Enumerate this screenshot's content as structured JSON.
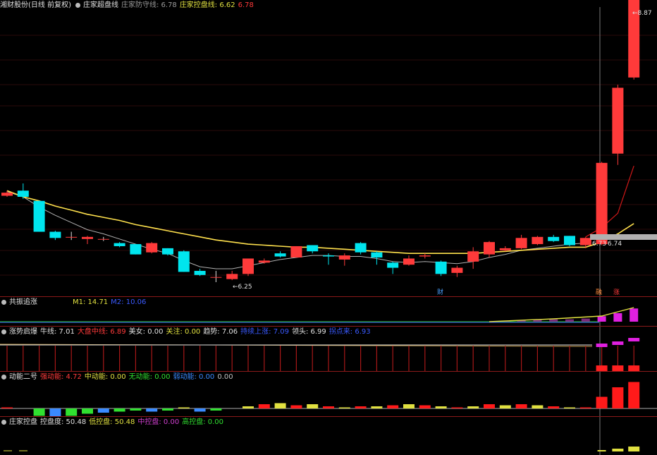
{
  "main": {
    "stock_title": "湘财股份(日线 前复权)",
    "indicator": "庄家超盘线",
    "defend_label": "庄家防守线: 6.78",
    "control_label": "庄家控盘线: 6.62",
    "extra_value": "6.78",
    "high_label": "8.87",
    "low_label": "6.25",
    "last_label_a": "6.73",
    "last_label_b": "6.74",
    "cai_badge": "财",
    "lu_badge": "融",
    "zhang_badge": "涨",
    "colors": {
      "up": "#ff3a3a",
      "down": "#00e5ee",
      "ma_fast": "#ffe14d",
      "ma_slow": "#b0b0b0",
      "ma_red": "#d01818"
    }
  },
  "panel2": {
    "name": "共振追涨",
    "m1": "M1: 14.71",
    "m2": "M2: 10.06"
  },
  "panel3": {
    "name": "涨势启爆",
    "items": [
      {
        "label": "牛线: 7.01",
        "color": "#e0e0e0"
      },
      {
        "label": "大盘中线: 6.89",
        "color": "#ff3a3a"
      },
      {
        "label": "美女: 0.00",
        "color": "#e0e0e0"
      },
      {
        "label": "关注: 0.00",
        "color": "#e0e040"
      },
      {
        "label": "趋势: 7.06",
        "color": "#e0e0e0"
      },
      {
        "label": "持续上涨: 7.09",
        "color": "#3a5aff"
      },
      {
        "label": "领头: 6.99",
        "color": "#e0e0e0"
      },
      {
        "label": "拐点来: 6.93",
        "color": "#3a5aff"
      }
    ]
  },
  "panel4": {
    "name": "动能二号",
    "items": [
      {
        "label": "强动能: 4.72",
        "color": "#ff3a3a"
      },
      {
        "label": "中动能: 0.00",
        "color": "#e0e040"
      },
      {
        "label": "无动能: 0.00",
        "color": "#30e030"
      },
      {
        "label": "弱动能: 0.00",
        "color": "#3a8aff"
      },
      {
        "label": "0.00",
        "color": "#c0c0c0"
      }
    ]
  },
  "panel5": {
    "name": "庄家控盘",
    "items": [
      {
        "label": "控盘度: 50.48",
        "color": "#e0e0e0"
      },
      {
        "label": "低控盘: 50.48",
        "color": "#e0e040"
      },
      {
        "label": "中控盘: 0.00",
        "color": "#d040d0"
      },
      {
        "label": "高控盘: 0.00",
        "color": "#30e030"
      }
    ]
  },
  "chart_data": {
    "type": "candlestick",
    "price_axis": {
      "low": 6.25,
      "high": 8.87
    },
    "candles": [
      {
        "o": 7.09,
        "c": 7.12,
        "h": 7.14,
        "l": 7.08
      },
      {
        "o": 7.14,
        "c": 7.08,
        "h": 7.21,
        "l": 7.06
      },
      {
        "o": 7.04,
        "c": 6.74,
        "h": 7.04,
        "l": 6.74
      },
      {
        "o": 6.74,
        "c": 6.68,
        "h": 6.75,
        "l": 6.66
      },
      {
        "o": 6.69,
        "c": 6.69,
        "h": 6.74,
        "l": 6.66
      },
      {
        "o": 6.67,
        "c": 6.69,
        "h": 6.7,
        "l": 6.62
      },
      {
        "o": 6.67,
        "c": 6.67,
        "h": 6.69,
        "l": 6.65
      },
      {
        "o": 6.63,
        "c": 6.6,
        "h": 6.64,
        "l": 6.59
      },
      {
        "o": 6.62,
        "c": 6.52,
        "h": 6.62,
        "l": 6.52
      },
      {
        "o": 6.54,
        "c": 6.63,
        "h": 6.64,
        "l": 6.53
      },
      {
        "o": 6.58,
        "c": 6.52,
        "h": 6.58,
        "l": 6.51
      },
      {
        "o": 6.55,
        "c": 6.35,
        "h": 6.56,
        "l": 6.35
      },
      {
        "o": 6.36,
        "c": 6.32,
        "h": 6.38,
        "l": 6.31
      },
      {
        "o": 6.3,
        "c": 6.3,
        "h": 6.36,
        "l": 6.25
      },
      {
        "o": 6.28,
        "c": 6.33,
        "h": 6.36,
        "l": 6.27
      },
      {
        "o": 6.33,
        "c": 6.48,
        "h": 6.48,
        "l": 6.31
      },
      {
        "o": 6.44,
        "c": 6.46,
        "h": 6.48,
        "l": 6.43
      },
      {
        "o": 6.53,
        "c": 6.5,
        "h": 6.55,
        "l": 6.49
      },
      {
        "o": 6.49,
        "c": 6.6,
        "h": 6.6,
        "l": 6.49
      },
      {
        "o": 6.61,
        "c": 6.55,
        "h": 6.61,
        "l": 6.53
      },
      {
        "o": 6.51,
        "c": 6.5,
        "h": 6.53,
        "l": 6.42
      },
      {
        "o": 6.47,
        "c": 6.51,
        "h": 6.53,
        "l": 6.41
      },
      {
        "o": 6.63,
        "c": 6.54,
        "h": 6.64,
        "l": 6.52
      },
      {
        "o": 6.54,
        "c": 6.49,
        "h": 6.55,
        "l": 6.42
      },
      {
        "o": 6.44,
        "c": 6.39,
        "h": 6.45,
        "l": 6.33
      },
      {
        "o": 6.42,
        "c": 6.48,
        "h": 6.51,
        "l": 6.41
      },
      {
        "o": 6.5,
        "c": 6.51,
        "h": 6.53,
        "l": 6.48
      },
      {
        "o": 6.45,
        "c": 6.33,
        "h": 6.46,
        "l": 6.31
      },
      {
        "o": 6.34,
        "c": 6.39,
        "h": 6.41,
        "l": 6.3
      },
      {
        "o": 6.45,
        "c": 6.55,
        "h": 6.59,
        "l": 6.38
      },
      {
        "o": 6.52,
        "c": 6.64,
        "h": 6.65,
        "l": 6.49
      },
      {
        "o": 6.56,
        "c": 6.58,
        "h": 6.6,
        "l": 6.55
      },
      {
        "o": 6.58,
        "c": 6.68,
        "h": 6.71,
        "l": 6.57
      },
      {
        "o": 6.62,
        "c": 6.69,
        "h": 6.7,
        "l": 6.61
      },
      {
        "o": 6.69,
        "c": 6.65,
        "h": 6.71,
        "l": 6.64
      },
      {
        "o": 6.7,
        "c": 6.61,
        "h": 6.7,
        "l": 6.6
      },
      {
        "o": 6.61,
        "c": 6.68,
        "h": 6.69,
        "l": 6.58
      },
      {
        "o": 6.62,
        "c": 7.41,
        "h": 7.42,
        "l": 6.61
      },
      {
        "o": 7.5,
        "c": 8.14,
        "h": 8.17,
        "l": 7.39
      },
      {
        "o": 8.24,
        "c": 9.02,
        "h": 9.03,
        "l": 8.22
      }
    ],
    "ma_yellow": [
      7.14,
      7.08,
      7.04,
      6.99,
      6.95,
      6.91,
      6.88,
      6.85,
      6.81,
      6.78,
      6.75,
      6.72,
      6.69,
      6.66,
      6.64,
      6.62,
      6.61,
      6.6,
      6.59,
      6.59,
      6.58,
      6.57,
      6.56,
      6.55,
      6.54,
      6.53,
      6.53,
      6.53,
      6.53,
      6.53,
      6.54,
      6.55,
      6.56,
      6.57,
      6.58,
      6.59,
      6.59,
      6.64,
      6.72,
      6.82
    ],
    "ma_gray": [
      7.13,
      7.08,
      6.98,
      6.9,
      6.83,
      6.76,
      6.72,
      6.67,
      6.62,
      6.57,
      6.53,
      6.46,
      6.4,
      6.38,
      6.38,
      6.41,
      6.44,
      6.47,
      6.49,
      6.51,
      6.51,
      6.5,
      6.5,
      6.48,
      6.45,
      6.44,
      6.45,
      6.44,
      6.43,
      6.45,
      6.49,
      6.52,
      6.56,
      6.58,
      6.6,
      6.62,
      6.63
    ],
    "ma_red": [
      6.69,
      6.78,
      6.92,
      7.38
    ],
    "p2_bars": [
      0,
      0,
      0,
      0,
      0,
      0,
      0,
      0,
      0,
      0,
      0,
      0,
      0,
      0,
      0,
      0,
      0,
      0,
      0,
      0,
      0,
      0,
      0,
      0,
      0,
      0,
      0,
      0,
      0,
      0,
      0,
      0.05,
      0.1,
      0.12,
      0.15,
      0.15,
      0.2,
      0.35,
      0.55,
      0.85
    ],
    "p4_bars": [
      0.05,
      0,
      -0.35,
      -0.4,
      -0.35,
      -0.25,
      -0.2,
      -0.15,
      -0.1,
      -0.15,
      -0.1,
      0.05,
      -0.15,
      -0.1,
      0,
      0.1,
      0.2,
      0.25,
      0.15,
      0.2,
      0.1,
      0.05,
      0.1,
      0.1,
      0.15,
      0.2,
      0.15,
      0.1,
      0.05,
      0.1,
      0.2,
      0.15,
      0.2,
      0.15,
      0.1,
      0.05,
      0.05,
      0.55,
      1.0,
      1.25
    ]
  }
}
